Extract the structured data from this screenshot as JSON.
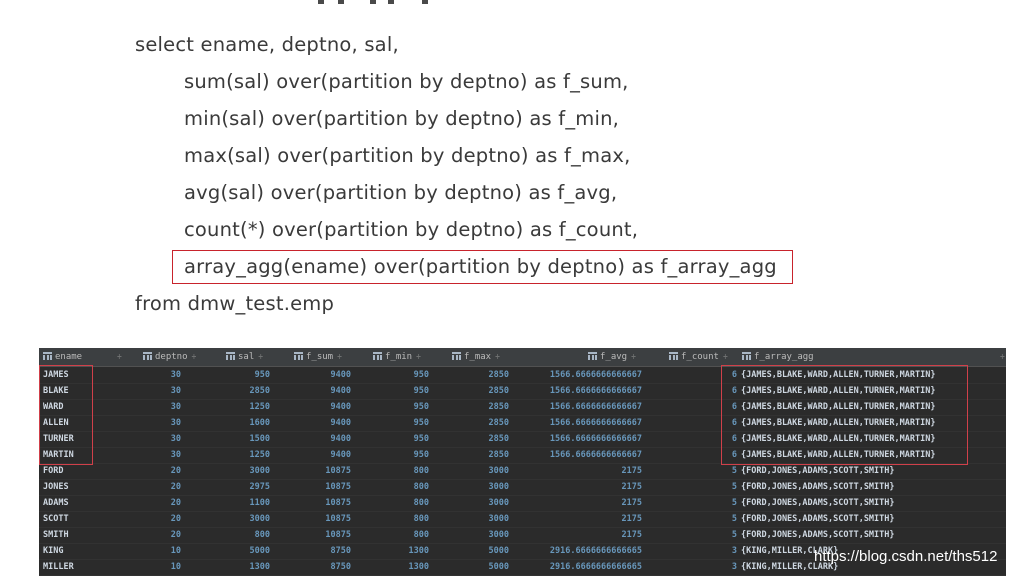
{
  "sql": {
    "lines": [
      "select ename, deptno, sal,",
      "sum(sal) over(partition by deptno) as f_sum,",
      "min(sal) over(partition by deptno) as f_min,",
      "max(sal) over(partition by deptno) as f_max,",
      "avg(sal) over(partition by deptno) as f_avg,",
      "count(*) over(partition by deptno) as f_count,",
      "array_agg(ename) over(partition by deptno) as f_array_agg",
      "from dmw_test.emp"
    ],
    "highlight_color": "#c8232c"
  },
  "result_grid": {
    "columns": [
      "ename",
      "deptno",
      "sal",
      "f_sum",
      "f_min",
      "f_max",
      "f_avg",
      "f_count",
      "f_array_agg"
    ],
    "sort_glyph": "÷",
    "rows": [
      [
        "JAMES",
        "30",
        "950",
        "9400",
        "950",
        "2850",
        "1566.6666666666667",
        "6",
        "{JAMES,BLAKE,WARD,ALLEN,TURNER,MARTIN}"
      ],
      [
        "BLAKE",
        "30",
        "2850",
        "9400",
        "950",
        "2850",
        "1566.6666666666667",
        "6",
        "{JAMES,BLAKE,WARD,ALLEN,TURNER,MARTIN}"
      ],
      [
        "WARD",
        "30",
        "1250",
        "9400",
        "950",
        "2850",
        "1566.6666666666667",
        "6",
        "{JAMES,BLAKE,WARD,ALLEN,TURNER,MARTIN}"
      ],
      [
        "ALLEN",
        "30",
        "1600",
        "9400",
        "950",
        "2850",
        "1566.6666666666667",
        "6",
        "{JAMES,BLAKE,WARD,ALLEN,TURNER,MARTIN}"
      ],
      [
        "TURNER",
        "30",
        "1500",
        "9400",
        "950",
        "2850",
        "1566.6666666666667",
        "6",
        "{JAMES,BLAKE,WARD,ALLEN,TURNER,MARTIN}"
      ],
      [
        "MARTIN",
        "30",
        "1250",
        "9400",
        "950",
        "2850",
        "1566.6666666666667",
        "6",
        "{JAMES,BLAKE,WARD,ALLEN,TURNER,MARTIN}"
      ],
      [
        "FORD",
        "20",
        "3000",
        "10875",
        "800",
        "3000",
        "2175",
        "5",
        "{FORD,JONES,ADAMS,SCOTT,SMITH}"
      ],
      [
        "JONES",
        "20",
        "2975",
        "10875",
        "800",
        "3000",
        "2175",
        "5",
        "{FORD,JONES,ADAMS,SCOTT,SMITH}"
      ],
      [
        "ADAMS",
        "20",
        "1100",
        "10875",
        "800",
        "3000",
        "2175",
        "5",
        "{FORD,JONES,ADAMS,SCOTT,SMITH}"
      ],
      [
        "SCOTT",
        "20",
        "3000",
        "10875",
        "800",
        "3000",
        "2175",
        "5",
        "{FORD,JONES,ADAMS,SCOTT,SMITH}"
      ],
      [
        "SMITH",
        "20",
        "800",
        "10875",
        "800",
        "3000",
        "2175",
        "5",
        "{FORD,JONES,ADAMS,SCOTT,SMITH}"
      ],
      [
        "KING",
        "10",
        "5000",
        "8750",
        "1300",
        "5000",
        "2916.6666666666665",
        "3",
        "{KING,MILLER,CLARK}"
      ],
      [
        "MILLER",
        "10",
        "1300",
        "8750",
        "1300",
        "5000",
        "2916.6666666666665",
        "3",
        "{KING,MILLER,CLARK}"
      ]
    ],
    "colors": {
      "background": "#2b2b2b",
      "header_background": "#3c3f41",
      "text": "#cfd8e2",
      "number": "#6897bb",
      "highlight_box": "#d0404a"
    }
  },
  "watermark": "https://blog.csdn.net/ths512"
}
